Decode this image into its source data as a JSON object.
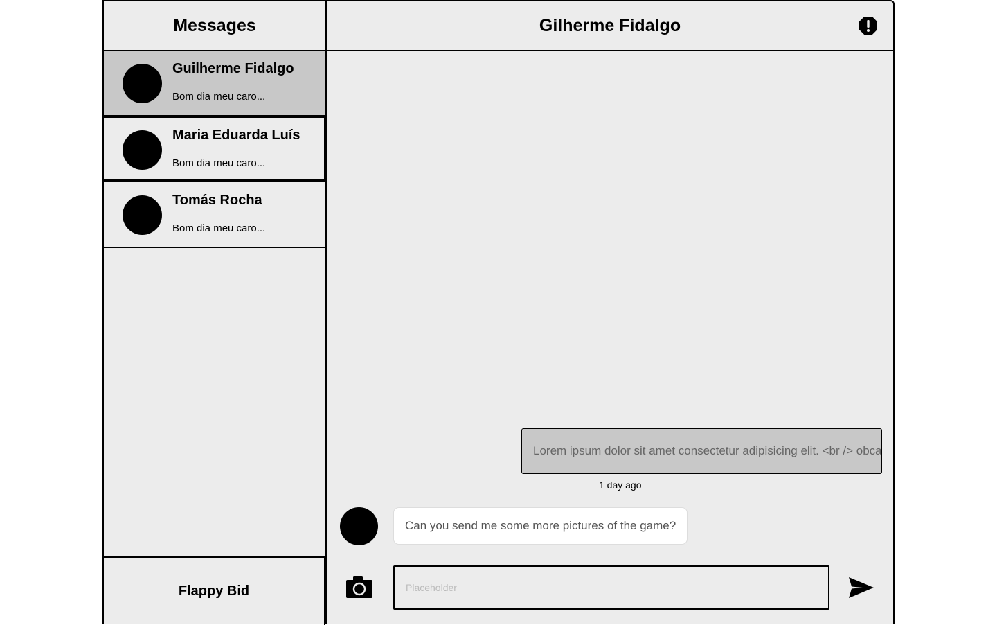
{
  "sidebar": {
    "title": "Messages",
    "conversations": [
      {
        "name": "Guilherme Fidalgo",
        "preview": "Bom dia meu caro...",
        "active": true
      },
      {
        "name": "Maria Eduarda Luís",
        "preview": "Bom dia meu caro...",
        "active": false
      },
      {
        "name": "Tomás Rocha",
        "preview": "Bom dia meu caro...",
        "active": false
      }
    ],
    "footer": "Flappy Bid"
  },
  "chat": {
    "title": "Gilherme Fidalgo",
    "report_icon": "alert-octagon-icon",
    "messages": [
      {
        "direction": "sent",
        "text": "Lorem ipsum dolor sit amet consectetur adipisicing elit. <br /> obcaecati",
        "time": "1 day ago"
      },
      {
        "direction": "received",
        "text": "Can you send me some more pictures of the game?"
      }
    ],
    "input": {
      "placeholder": "Placeholder",
      "value": ""
    },
    "camera_icon": "camera-icon",
    "send_icon": "send-icon"
  }
}
